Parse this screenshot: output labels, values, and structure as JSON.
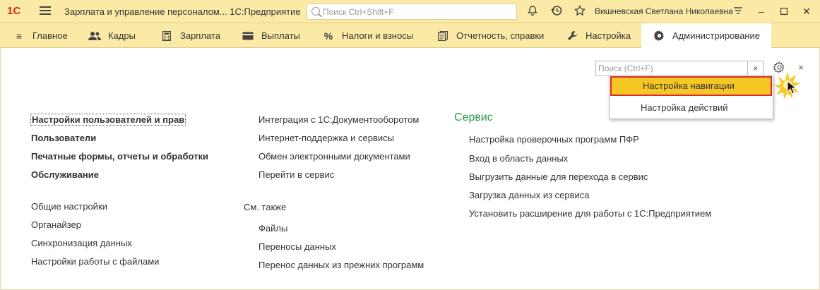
{
  "titlebar": {
    "logo": "1С",
    "title": "Зарплата и управление персоналом... 1С:Предприятие",
    "search_placeholder": "Поиск Ctrl+Shift+F",
    "user": "Вишневская Светлана Николаевна",
    "icons": [
      "bell-icon",
      "history-icon",
      "star-icon",
      "settings-lines-icon",
      "minimize-icon",
      "maximize-icon",
      "close-icon"
    ]
  },
  "menu": {
    "items": [
      {
        "label": "Главное",
        "icon": "burger-icon"
      },
      {
        "label": "Кадры",
        "icon": "people-icon"
      },
      {
        "label": "Зарплата",
        "icon": "calculator-icon"
      },
      {
        "label": "Выплаты",
        "icon": "wallet-icon"
      },
      {
        "label": "Налоги и взносы",
        "icon": "percent-icon"
      },
      {
        "label": "Отчетность, справки",
        "icon": "report-icon"
      },
      {
        "label": "Настройка",
        "icon": "wrench-icon"
      },
      {
        "label": "Администрирование",
        "icon": "gear-icon"
      }
    ],
    "active": "Администрирование"
  },
  "panel": {
    "search_placeholder": "Поиск (Ctrl+F)",
    "clear": "×",
    "close": "×",
    "dropdown": {
      "items": [
        "Настройка навигации",
        "Настройка действий"
      ],
      "highlighted": "Настройка навигации"
    }
  },
  "col1": {
    "bold": [
      "Настройки пользователей и прав",
      "Пользователи",
      "Печатные формы, отчеты и обработки",
      "Обслуживание"
    ],
    "normal": [
      "Общие настройки",
      "Органайзер",
      "Синхронизация данных",
      "Настройки работы с файлами"
    ]
  },
  "col2": {
    "links": [
      "Интеграция с 1С:Документооборотом",
      "Интернет-поддержка и сервисы",
      "Обмен электронными документами",
      "Перейти в сервис"
    ],
    "see_also_title": "См. также",
    "see_also": [
      "Файлы",
      "Переносы данных",
      "Перенос данных из прежних программ"
    ]
  },
  "col3": {
    "title": "Сервис",
    "links": [
      "Настройка проверочных программ ПФР",
      "Вход в область данных",
      "Выгрузить данные для перехода в сервис",
      "Загрузка данных из сервиса",
      "Установить расширение для работы с 1С:Предприятием"
    ]
  },
  "colors": {
    "bar": "#fbeaa6",
    "highlight": "#f6c724",
    "highlight_border": "#d92b2b",
    "section": "#2b9e48"
  }
}
